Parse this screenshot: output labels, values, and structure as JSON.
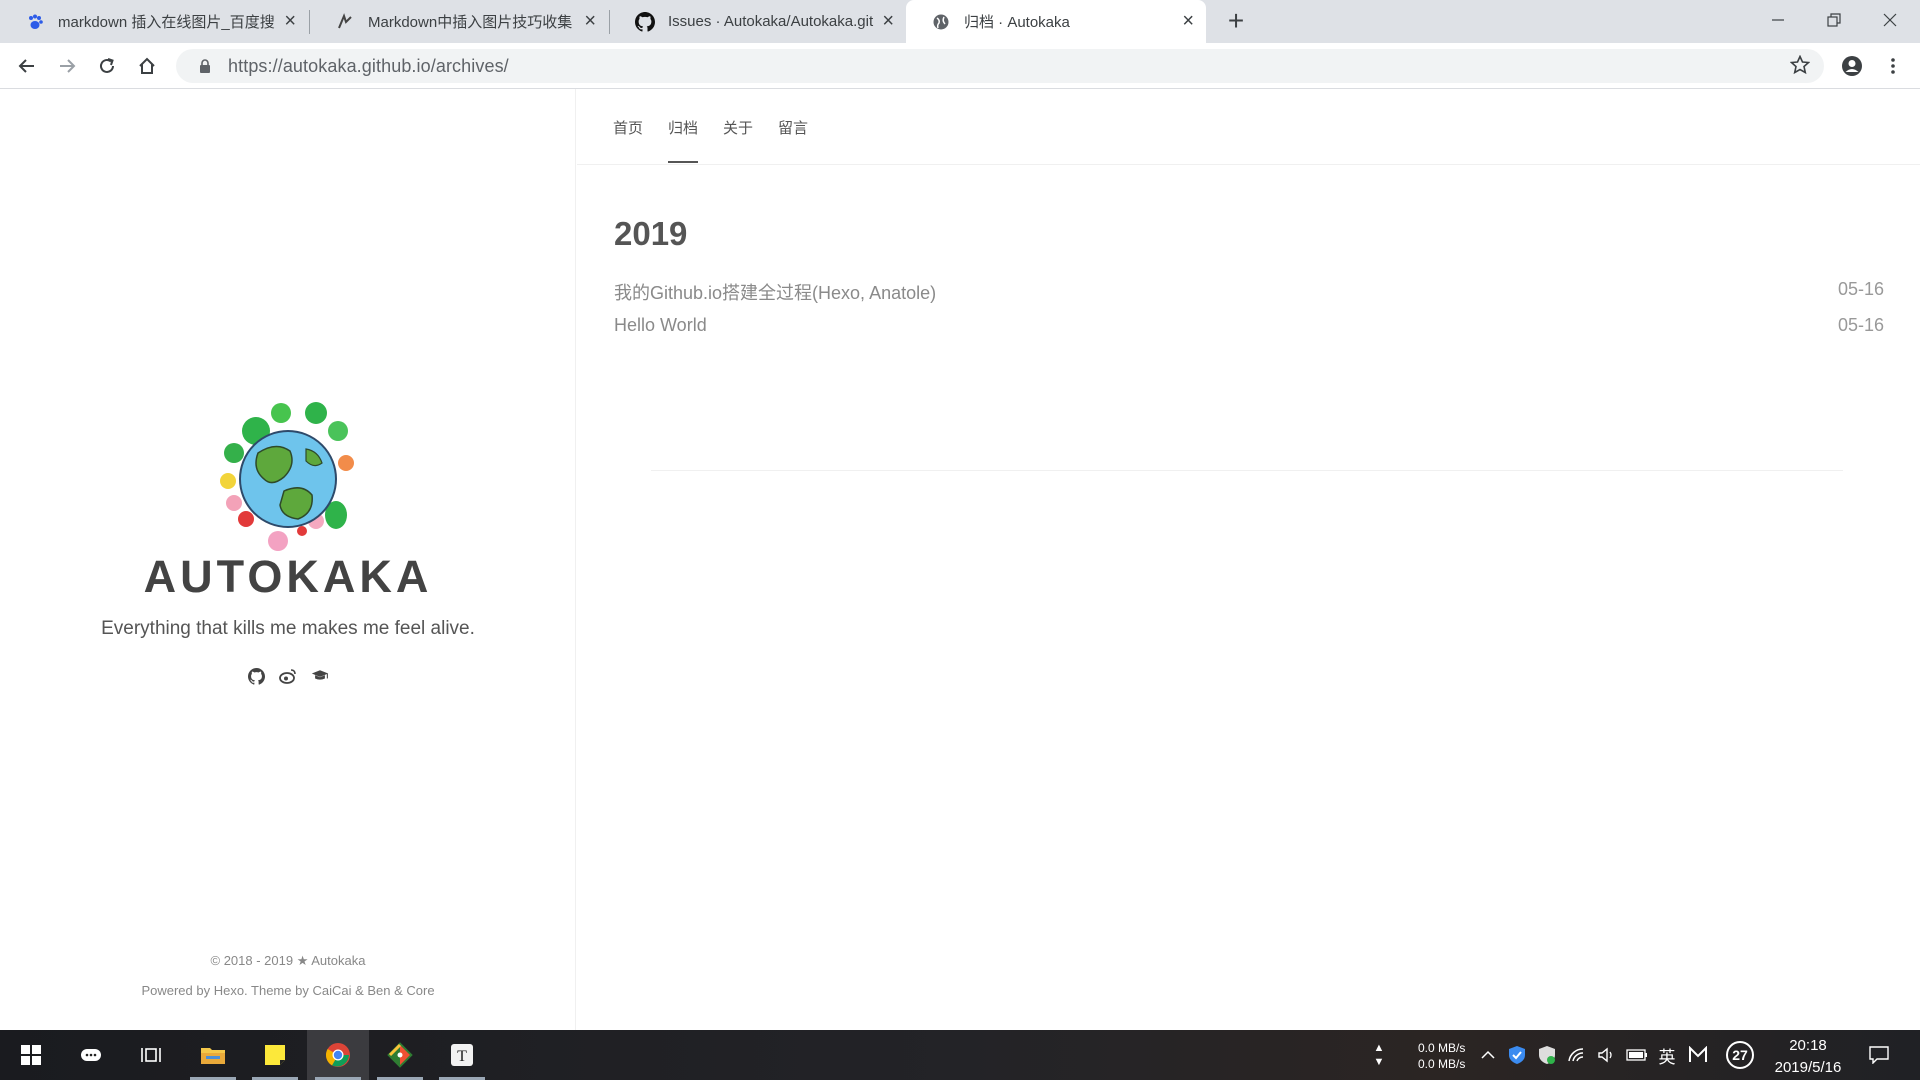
{
  "browser": {
    "tabs": [
      {
        "title": "markdown 插入在线图片_百度搜",
        "icon": "baidu-paw-icon",
        "active": false
      },
      {
        "title": "Markdown中插入图片技巧收集",
        "icon": "jianshu-icon",
        "active": false
      },
      {
        "title": "Issues · Autokaka/Autokaka.git",
        "icon": "github-icon",
        "active": false
      },
      {
        "title": "归档 · Autokaka",
        "icon": "globe-icon",
        "active": true
      }
    ],
    "new_tab": "+",
    "url_host": "https://autokaka.github.io",
    "url_path": "/archives/"
  },
  "site": {
    "title": "AUTOKAKA",
    "description": "Everything that kills me makes me feel alive.",
    "social_icons": [
      "github-icon",
      "weibo-icon",
      "graduation-cap-icon"
    ],
    "copyright": "© 2018 - 2019 ★ Autokaka",
    "powered_by": "Powered by Hexo. Theme by CaiCai & Ben & Core"
  },
  "nav": {
    "items": [
      {
        "label": "首页",
        "active": false
      },
      {
        "label": "归档",
        "active": true
      },
      {
        "label": "关于",
        "active": false
      },
      {
        "label": "留言",
        "active": false
      }
    ]
  },
  "archive": {
    "year": "2019",
    "posts": [
      {
        "title": "我的Github.io搭建全过程(Hexo, Anatole)",
        "date": "05-16"
      },
      {
        "title": "Hello World",
        "date": "05-16"
      }
    ]
  },
  "taskbar": {
    "apps": [
      "windows-start-icon",
      "cortana-icon",
      "task-view-icon",
      "file-explorer-icon",
      "sticky-notes-icon",
      "chrome-icon",
      "git-icon",
      "typora-icon"
    ],
    "net_up": "0.0 MB/s",
    "net_down": "0.0 MB/s",
    "ime": "英",
    "notification_count": "27",
    "time": "20:18",
    "date": "2019/5/16"
  },
  "colors": {
    "tabbar_bg": "#dee1e6",
    "text_main": "#555555",
    "post_title": "#8a8a8a"
  }
}
